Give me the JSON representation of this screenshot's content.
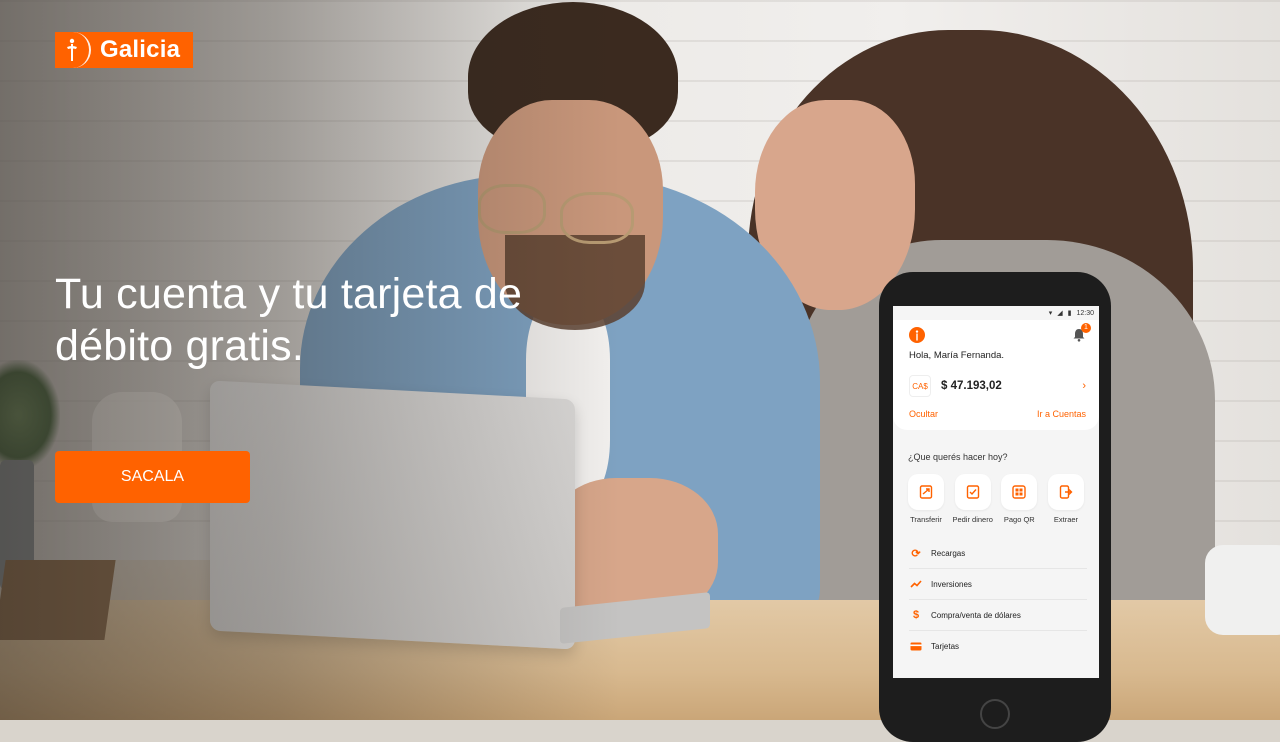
{
  "brand": {
    "name": "Galicia",
    "accent": "#ff6200"
  },
  "hero": {
    "headline_line1": "Tu cuenta y tu tarjeta de",
    "headline_line2": "débito gratis.",
    "cta_label": "SACALA"
  },
  "phone": {
    "status_time": "12:30",
    "notification_count": "1",
    "greeting": "Hola, María Fernanda.",
    "account": {
      "type": "CA$",
      "balance": "$ 47.193,02"
    },
    "hide_label": "Ocultar",
    "go_accounts_label": "Ir a Cuentas",
    "question": "¿Que querés hacer hoy?",
    "actions": [
      {
        "label": "Transferir",
        "icon": "transfer-icon"
      },
      {
        "label": "Pedir dinero",
        "icon": "request-money-icon"
      },
      {
        "label": "Pago QR",
        "icon": "qr-icon"
      },
      {
        "label": "Extraer",
        "icon": "withdraw-icon"
      }
    ],
    "menu": [
      {
        "label": "Recargas",
        "icon": "refresh-icon"
      },
      {
        "label": "Inversiones",
        "icon": "trend-icon"
      },
      {
        "label": "Compra/venta de dólares",
        "icon": "dollar-icon"
      },
      {
        "label": "Tarjetas",
        "icon": "card-icon"
      }
    ]
  }
}
